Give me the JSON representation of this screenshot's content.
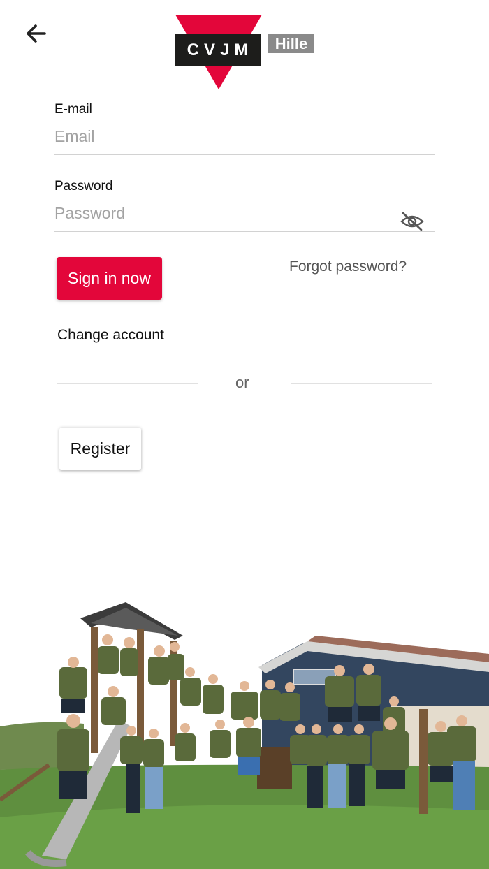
{
  "header": {
    "back_icon": "arrow-left-icon",
    "logo_text": "CVJM",
    "logo_sub": "Hille",
    "logo_colors": {
      "triangle": "#e3063a",
      "bar": "#1d1d1b",
      "sub": "#8a8a8a"
    }
  },
  "email": {
    "label": "E-mail",
    "placeholder": "Email",
    "value": ""
  },
  "password": {
    "label": "Password",
    "placeholder": "Password",
    "value": "",
    "toggle_icon": "eye-off-icon"
  },
  "actions": {
    "sign_in_label": "Sign in now",
    "forgot_label": "Forgot password?",
    "change_account_label": "Change account",
    "or_label": "or",
    "register_label": "Register"
  },
  "colors": {
    "accent": "#e3063a",
    "muted_text": "#555555",
    "placeholder": "#a3a3a3"
  },
  "photo": {
    "subject": "group-photo-on-playground"
  }
}
